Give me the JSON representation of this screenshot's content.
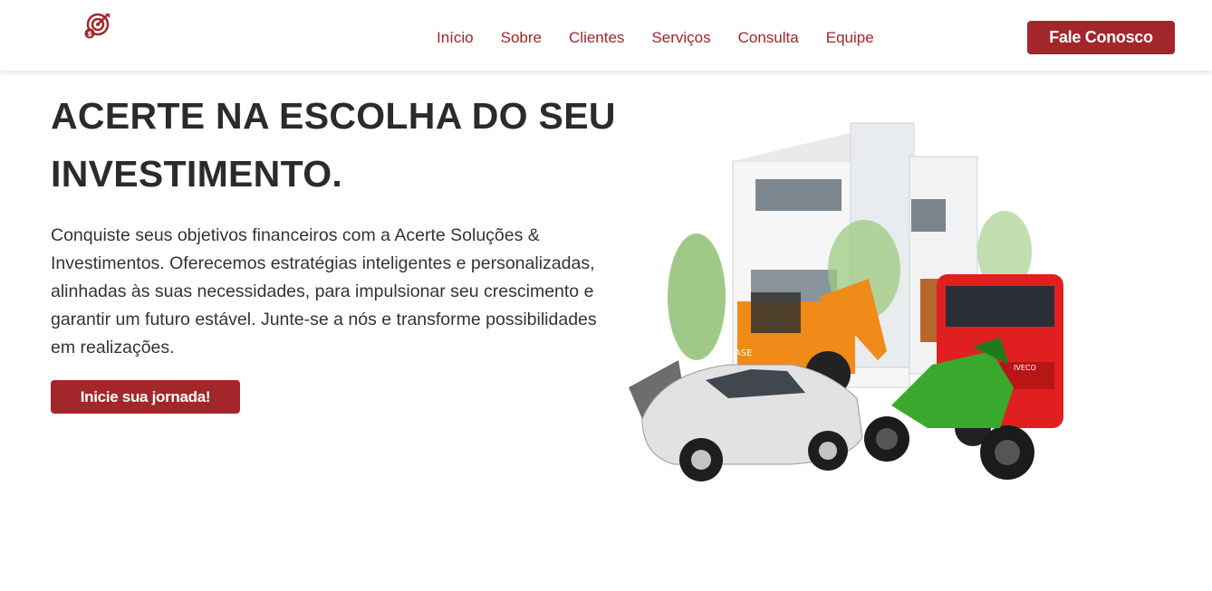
{
  "header": {
    "logo_icon": "target-icon",
    "nav": [
      "Início",
      "Sobre",
      "Clientes",
      "Serviços",
      "Consulta",
      "Equipe"
    ],
    "cta_label": "Fale Conosco"
  },
  "hero": {
    "title": "ACERTE NA ESCOLHA DO SEU INVESTIMENTO.",
    "text": "Conquiste seus objetivos financeiros com a Acerte Soluções & Investimentos. Oferecemos estratégias inteligentes e personalizadas, alinhadas às suas necessidades, para impulsionar seu crescimento e garantir um futuro estável. Junte-se a nós e transforme possibilidades em realizações.",
    "button_label": "Inicie sua jornada!",
    "image_brands": {
      "backhoe": "CASE",
      "truck": "IVECO"
    }
  },
  "colors": {
    "accent": "#a3262a",
    "text": "#2b2b2b",
    "background": "#ffffff"
  }
}
